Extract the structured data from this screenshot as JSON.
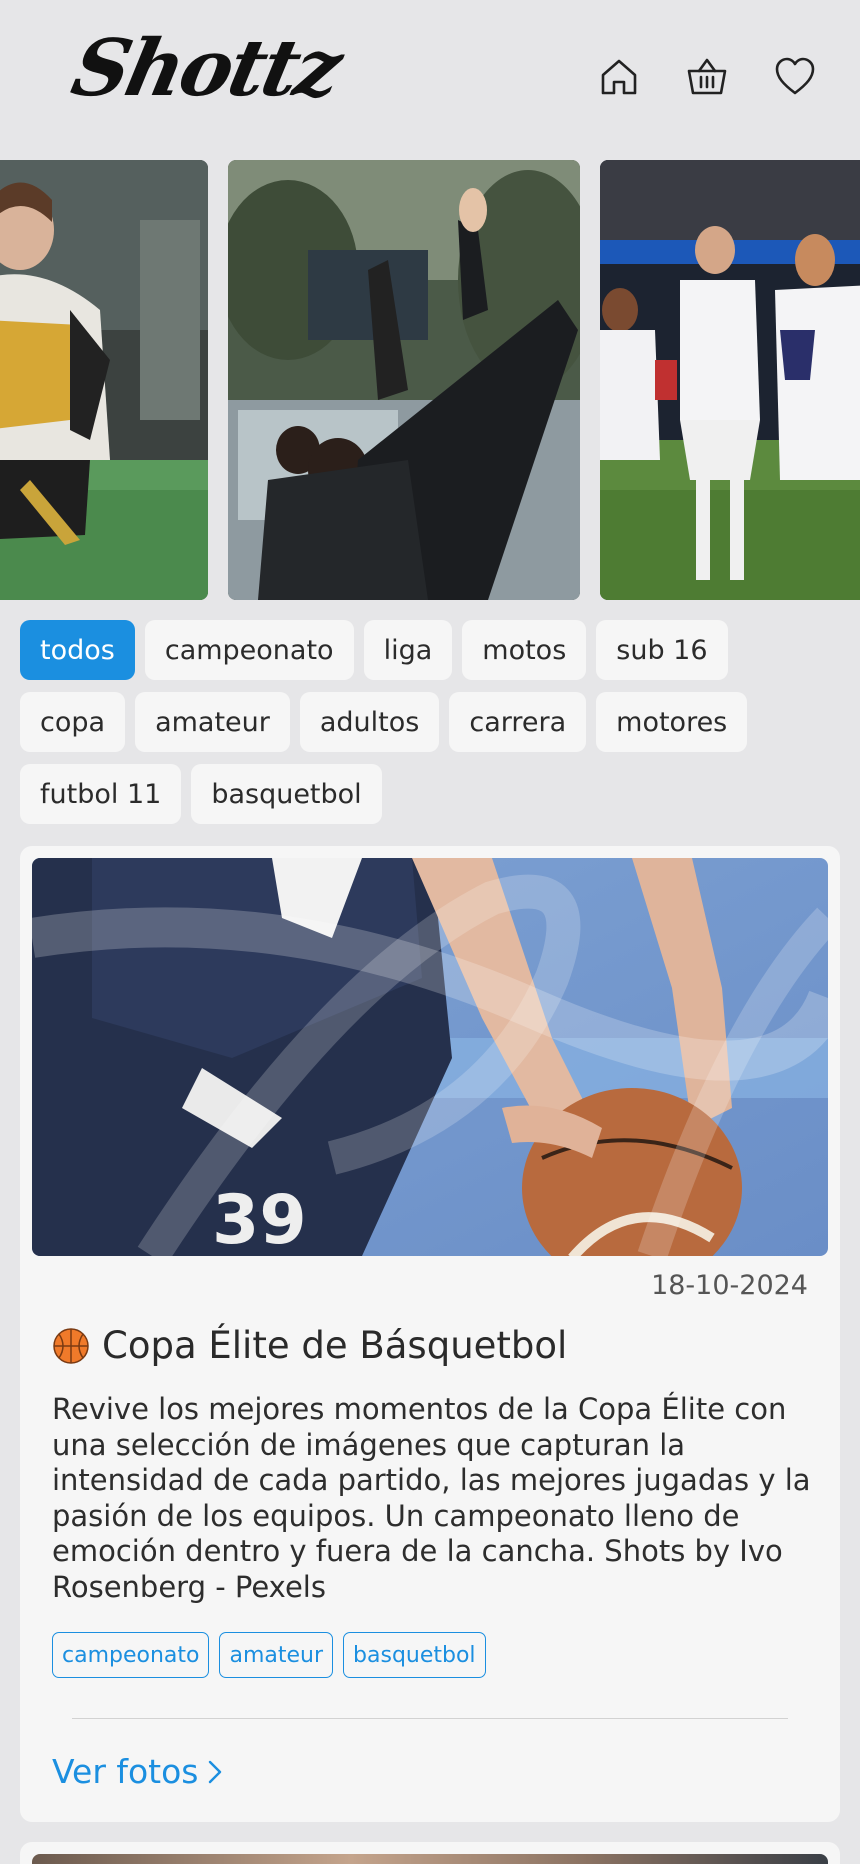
{
  "header": {
    "logo": "Shottz",
    "icons": [
      "home-icon",
      "basket-icon",
      "heart-icon"
    ]
  },
  "carousel": {
    "slides": [
      {
        "subject": "soccer-player"
      },
      {
        "subject": "team-stretching"
      },
      {
        "subject": "team-celebration"
      }
    ]
  },
  "filters": {
    "active": "todos",
    "items": [
      "todos",
      "campeonato",
      "liga",
      "motos",
      "sub 16",
      "copa",
      "amateur",
      "adultos",
      "carrera",
      "motores",
      "futbol 11",
      "basquetbol"
    ]
  },
  "card": {
    "date": "18-10-2024",
    "emoji_icon": "basketball-icon",
    "title": "Copa Élite de Básquetbol",
    "description": "Revive los mejores momentos de la Copa Élite con una selección de imágenes que capturan la intensidad de cada partido, las mejores jugadas y la pasión de los equipos. Un campeonato lleno de emoción dentro y fuera de la cancha. Shots by Ivo Rosenberg - Pexels",
    "tags": [
      "campeonato",
      "amateur",
      "basquetbol"
    ],
    "link_label": "Ver fotos"
  },
  "colors": {
    "accent": "#1b8fe0",
    "background": "#e6e6e8",
    "card": "#f6f6f6"
  }
}
